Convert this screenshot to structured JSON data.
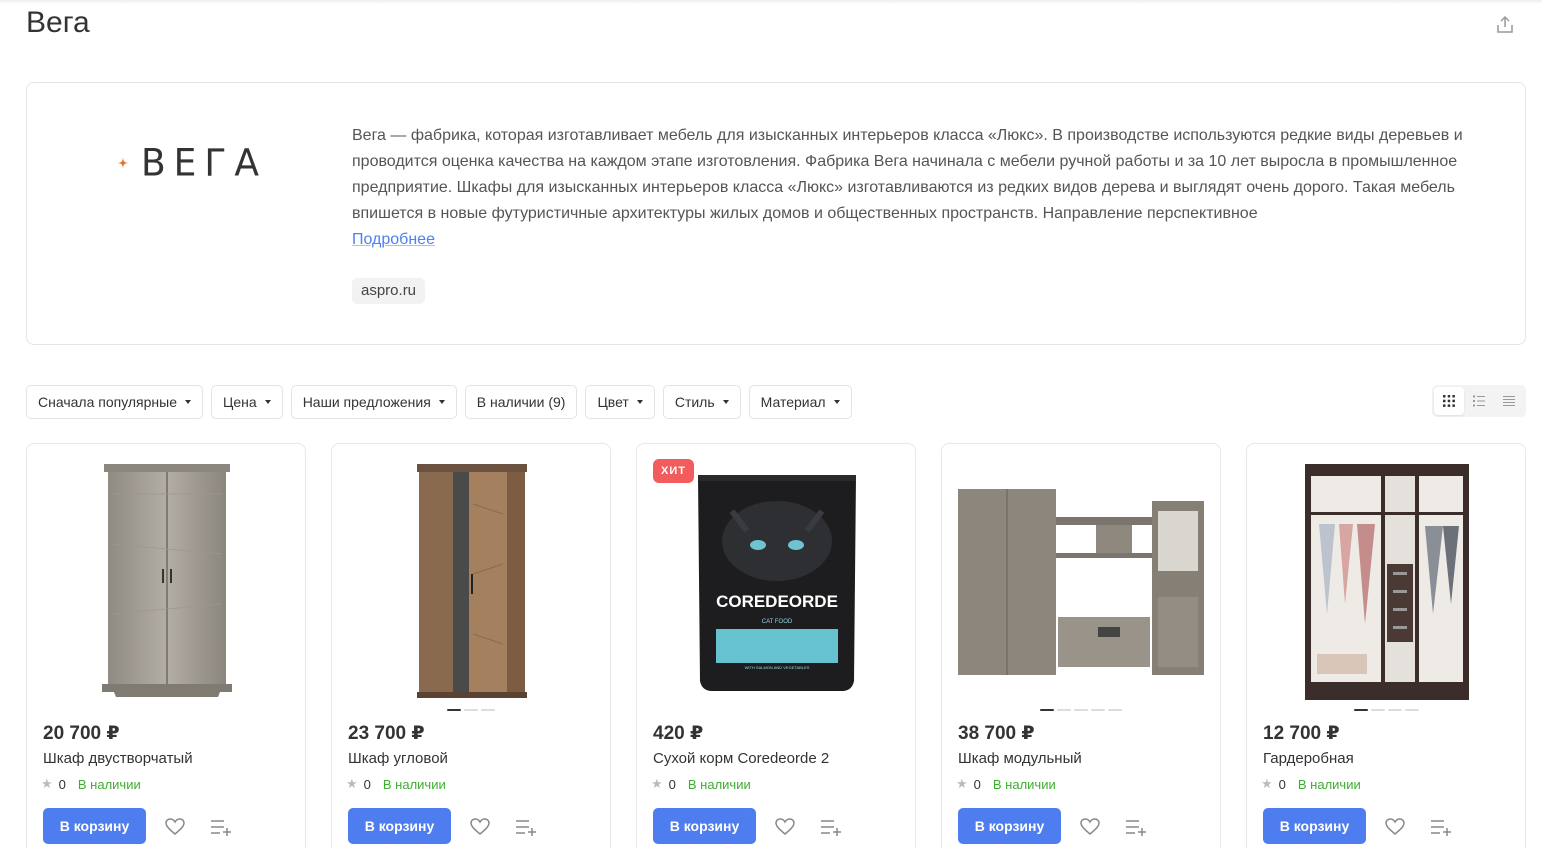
{
  "page": {
    "title": "Вега"
  },
  "brand": {
    "logo_text": "ВЕГА",
    "description": "Вега — фабрика, которая изготавливает мебель для изысканных интерьеров класса «Люкс». В производстве используются редкие виды деревьев и проводится оценка качества на каждом этапе изготовления. Фабрика Вега начинала с мебели ручной работы и за 10 лет выросла в промышленное предприятие. Шкафы для изысканных интерьеров класса «Люкс» изготавливаются из редких видов дерева и выглядят очень дорого. Такая мебель впишется в новые футуристичные архитектуры жилых домов и общественных пространств. Направление перспективное",
    "more_label": "Подробнее",
    "site": "aspro.ru",
    "accent_color": "#e8752e"
  },
  "filters": [
    {
      "label": "Сначала популярные",
      "dropdown": true
    },
    {
      "label": "Цена",
      "dropdown": true
    },
    {
      "label": "Наши предложения",
      "dropdown": true
    },
    {
      "label": "В наличии (9)",
      "dropdown": false
    },
    {
      "label": "Цвет",
      "dropdown": true
    },
    {
      "label": "Стиль",
      "dropdown": true
    },
    {
      "label": "Материал",
      "dropdown": true
    }
  ],
  "view_modes": [
    {
      "icon": "grid-view-icon",
      "active": true
    },
    {
      "icon": "list-view-icon",
      "active": false
    },
    {
      "icon": "table-view-icon",
      "active": false
    }
  ],
  "products": [
    {
      "price": "20 700 ₽",
      "name": "Шкаф двустворчатый",
      "rating": "0",
      "stock": "В наличии",
      "badge": "",
      "image": "wardrobe-2-door",
      "dots": 0
    },
    {
      "price": "23 700 ₽",
      "name": "Шкаф угловой",
      "rating": "0",
      "stock": "В наличии",
      "badge": "",
      "image": "wardrobe-corner",
      "dots": 3
    },
    {
      "price": "420 ₽",
      "name": "Сухой корм Coredeorde 2",
      "rating": "0",
      "stock": "В наличии",
      "badge": "ХИТ",
      "image": "cat-food-bag",
      "dots": 0
    },
    {
      "price": "38 700 ₽",
      "name": "Шкаф модульный",
      "rating": "0",
      "stock": "В наличии",
      "badge": "",
      "image": "wall-unit",
      "dots": 5
    },
    {
      "price": "12 700 ₽",
      "name": "Гардеробная",
      "rating": "0",
      "stock": "В наличии",
      "badge": "",
      "image": "walk-in-closet",
      "dots": 4
    }
  ],
  "labels": {
    "add_to_cart": "В корзину"
  },
  "colors": {
    "primary": "#4e7df0",
    "in_stock": "#3fad31",
    "hit_badge": "#f25c5c"
  }
}
